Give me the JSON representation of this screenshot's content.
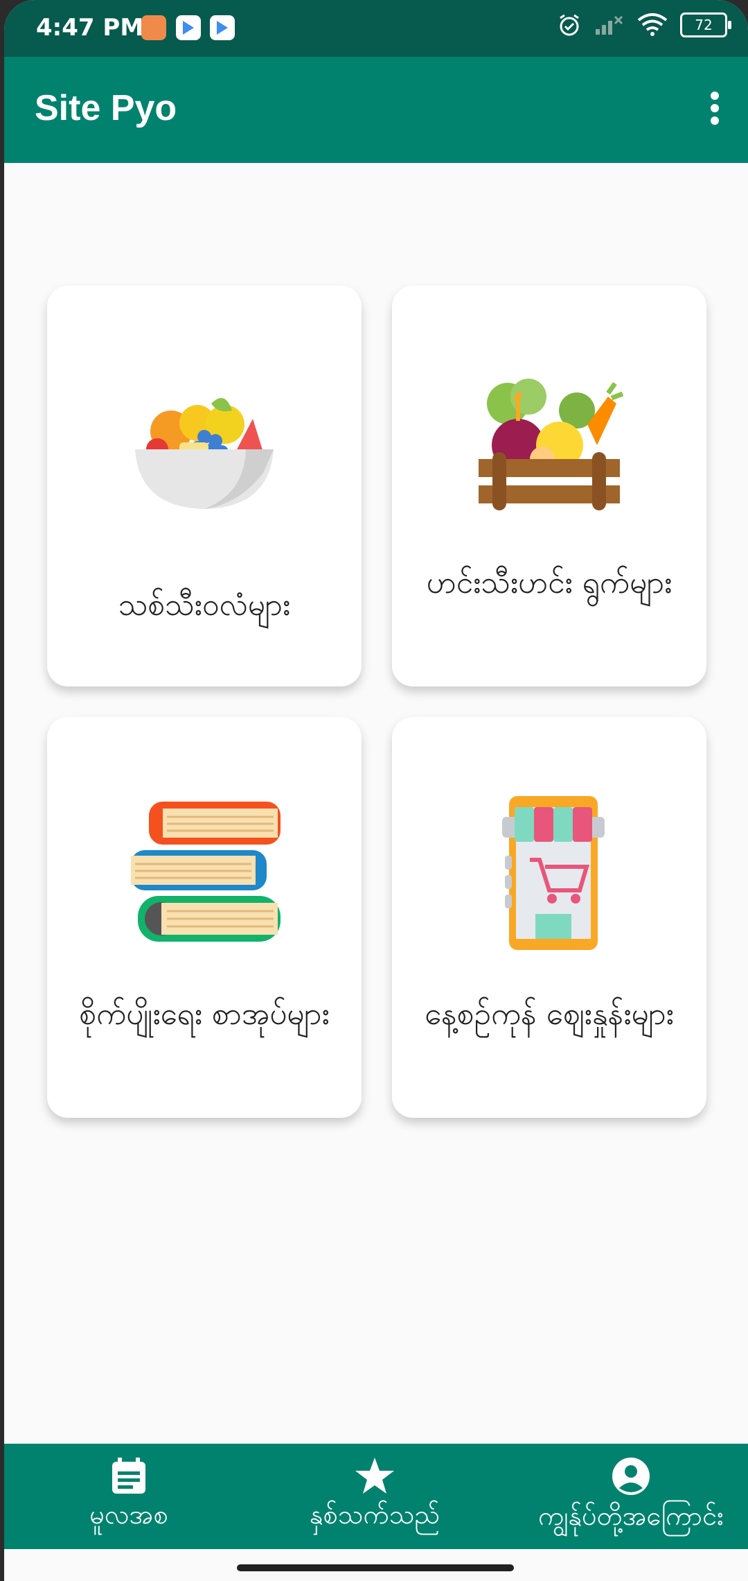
{
  "status_bar": {
    "time": "4:47 PM",
    "battery": "72",
    "icons": [
      "shopping-notification-icon",
      "play-store-icon",
      "play-store-icon",
      "alarm-icon",
      "signal-off-icon",
      "wifi-icon",
      "battery-icon"
    ]
  },
  "app_bar": {
    "title": "Site Pyo",
    "menu_icon": "more-vert-icon"
  },
  "cards": [
    {
      "label": "သစ်သီးဝလံများ",
      "icon": "fruit-bowl-icon"
    },
    {
      "label": "ဟင်းသီးဟင်း ရွက်များ",
      "icon": "vegetable-crate-icon"
    },
    {
      "label": "စိုက်ပျိုးရေး စာအုပ်များ",
      "icon": "books-icon"
    },
    {
      "label": "နေ့စဉ်ကုန် ဈေးနှုန်းများ",
      "icon": "market-phone-icon"
    }
  ],
  "bottom_nav": [
    {
      "label": "မူလအစ",
      "icon": "article-icon"
    },
    {
      "label": "နှစ်သက်သည်",
      "icon": "star-icon"
    },
    {
      "label": "ကျွန်ုပ်တို့အကြောင်း",
      "icon": "account-circle-icon"
    }
  ],
  "colors": {
    "primary": "#00826f",
    "primary_dark": "#075a4e",
    "background": "#fafafa",
    "card": "#ffffff"
  }
}
